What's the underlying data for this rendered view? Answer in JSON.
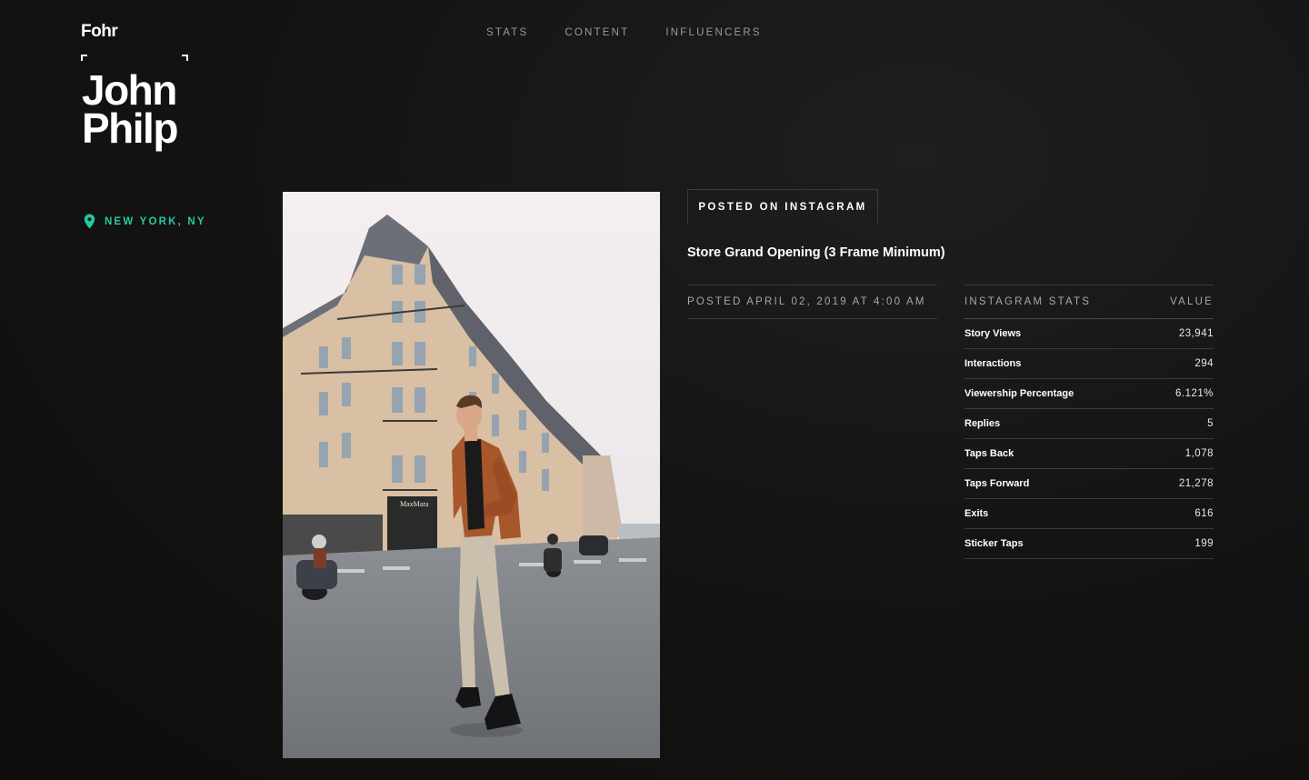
{
  "brand": {
    "logo": "Fohr"
  },
  "nav": {
    "items": [
      "STATS",
      "CONTENT",
      "INFLUENCERS"
    ]
  },
  "profile": {
    "first_name": "John",
    "last_name": "Philp",
    "location": "NEW YORK, NY",
    "accent": "#25c9a3"
  },
  "post": {
    "platform_badge": "POSTED ON INSTAGRAM",
    "title": "Store Grand Opening (3 Frame Minimum)",
    "posted_at": "POSTED APRIL 02, 2019 AT 4:00 AM",
    "photo_sign": "MaxMara"
  },
  "stats": {
    "header_label": "INSTAGRAM STATS",
    "header_value": "VALUE",
    "rows": [
      {
        "label": "Story Views",
        "value": "23,941"
      },
      {
        "label": "Interactions",
        "value": "294"
      },
      {
        "label": "Viewership Percentage",
        "value": "6.121%"
      },
      {
        "label": "Replies",
        "value": "5"
      },
      {
        "label": "Taps Back",
        "value": "1,078"
      },
      {
        "label": "Taps Forward",
        "value": "21,278"
      },
      {
        "label": "Exits",
        "value": "616"
      },
      {
        "label": "Sticker Taps",
        "value": "199"
      }
    ]
  }
}
